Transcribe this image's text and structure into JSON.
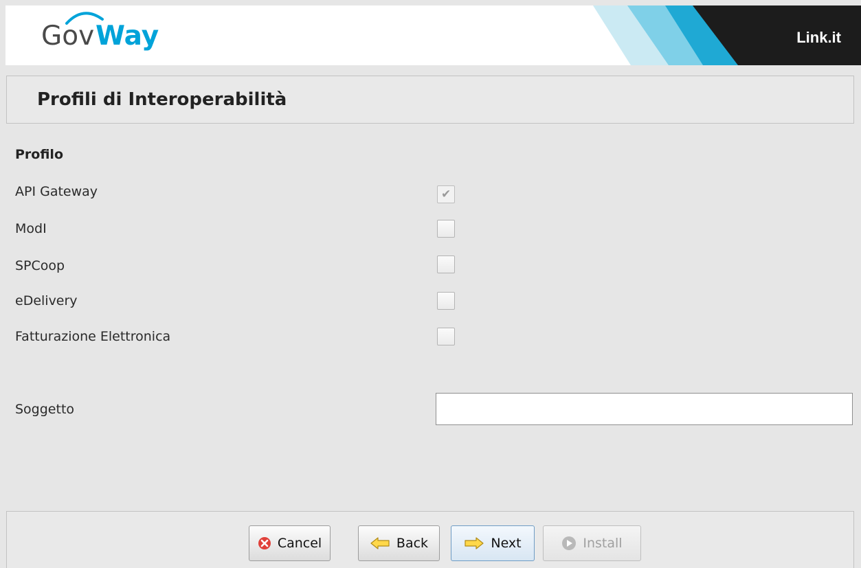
{
  "header": {
    "logo": {
      "part1": "Gov",
      "part2": "Way"
    },
    "brand": "Link.it"
  },
  "page": {
    "title": "Profili di Interoperabilità"
  },
  "profile": {
    "section_label": "Profilo",
    "options": [
      {
        "label": "API Gateway",
        "checked": true,
        "disabled": true
      },
      {
        "label": "ModI",
        "checked": false
      },
      {
        "label": "SPCoop",
        "checked": false
      },
      {
        "label": "eDelivery",
        "checked": false
      },
      {
        "label": "Fatturazione Elettronica",
        "checked": false
      }
    ]
  },
  "subject": {
    "label": "Soggetto",
    "value": ""
  },
  "buttons": {
    "cancel": {
      "label": "Cancel",
      "icon": "cancel-icon"
    },
    "back": {
      "label": "Back",
      "icon": "arrow-left-icon"
    },
    "next": {
      "label": "Next",
      "icon": "arrow-right-icon"
    },
    "install": {
      "label": "Install",
      "icon": "install-icon",
      "disabled": true
    }
  },
  "colors": {
    "accent_blue": "#00a3d9",
    "brand_dark": "#1c1c1c",
    "background": "#e6e6e6"
  }
}
